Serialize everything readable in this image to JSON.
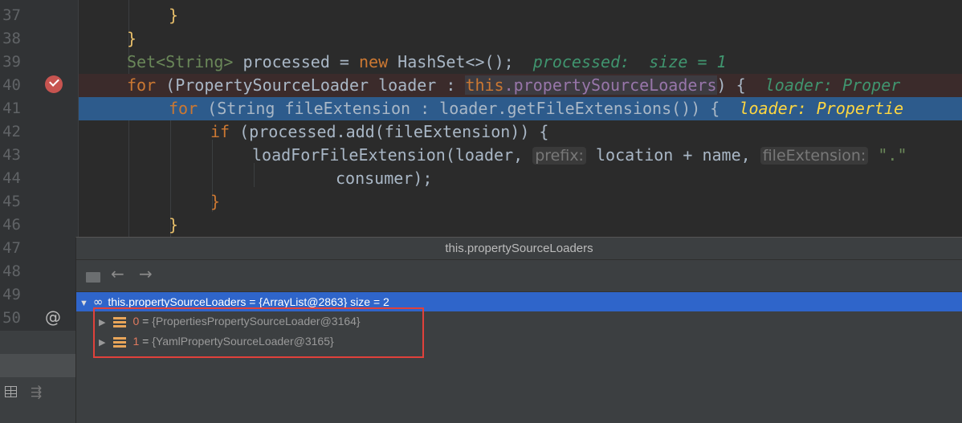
{
  "editor": {
    "line_numbers": [
      "37",
      "38",
      "39",
      "40",
      "41",
      "42",
      "43",
      "44",
      "45",
      "46",
      "47",
      "48",
      "49",
      "50"
    ],
    "code": {
      "l37": "}",
      "l38": "}",
      "l39_type": "Set<String>",
      "l39_var": " processed = ",
      "l39_new": "new",
      "l39_rest": " HashSet<>();",
      "l39_inline": "processed:  size = 1",
      "l40_for": "for",
      "l40_mid": " (PropertySourceLoader loader : ",
      "l40_this": "this",
      "l40_field": ".propertySourceLoaders",
      "l40_end": ") {",
      "l40_inline": "loader: Proper",
      "l41_for": "for",
      "l41_mid": " (String fileExtension : loader.getFileExtensions()) {",
      "l41_inline": "loader: Propertie",
      "l42_if": "if",
      "l42_rest": " (processed.add(fileExtension)) {",
      "l43_call": "loadForFileExtension(loader, ",
      "l43_hint1": "prefix:",
      "l43_arg1": " location + name, ",
      "l43_hint2": "fileExtension:",
      "l43_str": " \".\"",
      "l44": "consumer);",
      "l45": "}",
      "l46": "}"
    },
    "at_symbol": "@"
  },
  "popup": {
    "title": "this.propertySourceLoaders",
    "toolbar": {
      "back_icon": "←",
      "forward_icon": "→"
    },
    "root": {
      "text": "this.propertySourceLoaders = {ArrayList@2863}  size = 2"
    },
    "items": [
      {
        "index": "0",
        "value": "{PropertiesPropertySourceLoader@3164}"
      },
      {
        "index": "1",
        "value": "{YamlPropertySourceLoader@3165}"
      }
    ]
  },
  "colors": {
    "editor_bg": "#2b2b2b",
    "current_line": "#2d5b8c",
    "selection_blue": "#2f65ca",
    "highlight_box": "#e0413b",
    "keyword": "#cc7832"
  }
}
